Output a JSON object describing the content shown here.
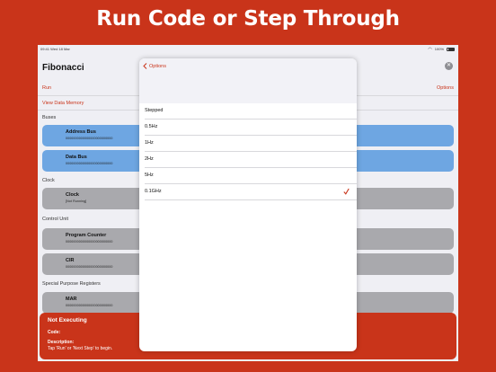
{
  "headline": "Run Code or Step Through",
  "status_bar": {
    "time": "09:41",
    "date": "Wed 18 Mar",
    "battery": "100%"
  },
  "app": {
    "title": "Fibonacci",
    "run_label": "Run",
    "options_label": "Options",
    "view_memory_label": "View Data Memory"
  },
  "sections": {
    "buses": "Buses",
    "clock": "Clock",
    "control_unit": "Control Unit",
    "special_registers": "Special Purpose Registers"
  },
  "cards": {
    "address_bus": {
      "title": "Address Bus",
      "value": "0000000000000000000000000"
    },
    "data_bus": {
      "title": "Data Bus",
      "value": "0000000000000000000000000"
    },
    "clock": {
      "title": "Clock",
      "value": "[Not Running]"
    },
    "program_counter": {
      "title": "Program Counter",
      "value": "0000000000000000000000000"
    },
    "cir": {
      "title": "CIR",
      "value": "0000000000000000000000000"
    },
    "mar": {
      "title": "MAR",
      "value": "0000000000000000000000000"
    }
  },
  "status_panel": {
    "title": "Not Executing",
    "code_label": "Code:",
    "description_label": "Description:",
    "description": "Tap 'Run' or 'Next Step' to begin."
  },
  "options_modal": {
    "back_label": "Options",
    "items": [
      {
        "label": "Stepped"
      },
      {
        "label": "0.5Hz"
      },
      {
        "label": "1Hz"
      },
      {
        "label": "2Hz"
      },
      {
        "label": "5Hz"
      },
      {
        "label": "0.1GHz"
      }
    ],
    "selected": "0.1GHz"
  },
  "colors": {
    "accent": "#c9341a",
    "bus_card": "#6ea6e2",
    "component_card": "#a9a9ad"
  }
}
